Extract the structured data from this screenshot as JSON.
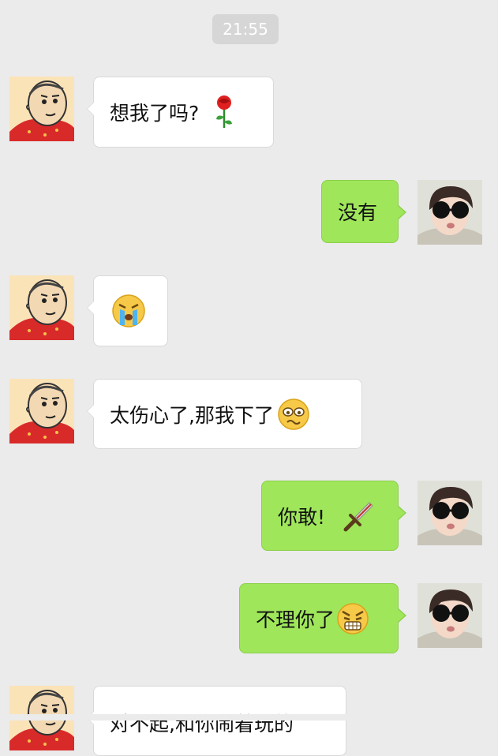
{
  "timestamp": "21:55",
  "messages": [
    {
      "side": "incoming",
      "text": "想我了吗?",
      "emoji": "rose-icon"
    },
    {
      "side": "outgoing",
      "text": "没有",
      "emoji": ""
    },
    {
      "side": "incoming",
      "text": "",
      "emoji": "crying-face-icon"
    },
    {
      "side": "incoming",
      "text": "太伤心了,那我下了",
      "emoji": "woozy-face-icon"
    },
    {
      "side": "outgoing",
      "text": "你敢!",
      "emoji": "sword-icon"
    },
    {
      "side": "outgoing",
      "text": "不理你了",
      "emoji": "angry-face-icon"
    },
    {
      "side": "incoming",
      "text": "对不起,和你闹着玩的",
      "emoji": ""
    }
  ]
}
